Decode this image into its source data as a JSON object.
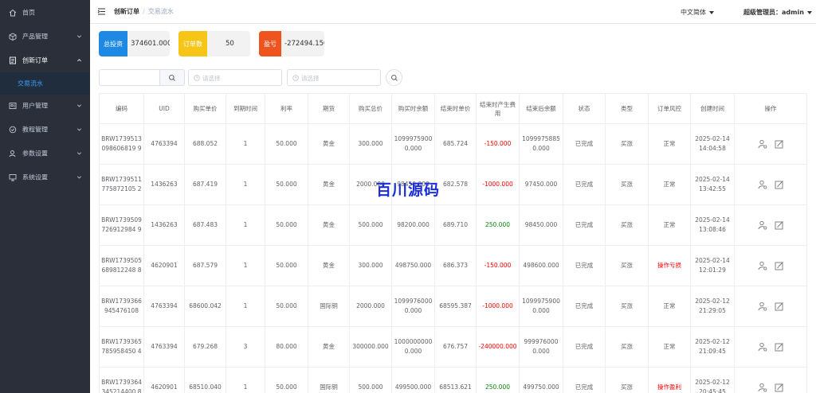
{
  "sidebar": {
    "items": [
      {
        "label": "首页",
        "icon": "home-icon"
      },
      {
        "label": "产品管理",
        "icon": "box-icon"
      },
      {
        "label": "创新订单",
        "icon": "order-icon"
      },
      {
        "label": "用户管理",
        "icon": "user-icon"
      },
      {
        "label": "教程管理",
        "icon": "book-icon"
      },
      {
        "label": "参数设置",
        "icon": "settings-icon"
      },
      {
        "label": "系统设置",
        "icon": "system-icon"
      }
    ],
    "sub_item": "交易流水"
  },
  "header": {
    "crumb1": "创新订单",
    "crumb2": "交易流水",
    "lang": "中文简体",
    "user": "超级管理员：admin"
  },
  "cards": [
    {
      "label": "总投资",
      "value": "374601.000",
      "color": "#1e88e5"
    },
    {
      "label": "订单数",
      "value": "50",
      "color": "#f5c518"
    },
    {
      "label": "盈亏",
      "value": "-272494.150",
      "color": "#f0541e"
    }
  ],
  "filters": {
    "date_placeholder1": "请选择",
    "date_placeholder2": "请选择"
  },
  "table": {
    "headers": [
      "编码",
      "UID",
      "购买单价",
      "到期时间",
      "利率",
      "期货",
      "购买总价",
      "购买时余额",
      "结束时单价",
      "结束时产生费用",
      "结束后余额",
      "状态",
      "类型",
      "订单风控",
      "创建时间",
      "操作"
    ],
    "rows": [
      [
        "BRW1739513098606819 9",
        "4763394",
        "688.052",
        "1",
        "50.000",
        "黄金",
        "300.000",
        "10999759000.000",
        "685.724",
        "-150.000",
        "10999758850.000",
        "已完成",
        "买涨",
        "正常",
        "2025-02-14 14:04:58"
      ],
      [
        "BRW1739511775872105 2",
        "1436263",
        "687.419",
        "1",
        "50.000",
        "黄金",
        "2000.000",
        "98450.000",
        "682.578",
        "-1000.000",
        "97450.000",
        "已完成",
        "买涨",
        "正常",
        "2025-02-14 13:42:55"
      ],
      [
        "BRW1739509726912984 9",
        "1436263",
        "687.483",
        "1",
        "50.000",
        "黄金",
        "500.000",
        "98200.000",
        "689.710",
        "250.000",
        "98450.000",
        "已完成",
        "买涨",
        "正常",
        "2025-02-14 13:08:46"
      ],
      [
        "BRW1739505689812248 8",
        "4620901",
        "687.579",
        "1",
        "50.000",
        "黄金",
        "300.000",
        "498750.000",
        "686.373",
        "-150.000",
        "498600.000",
        "已完成",
        "买涨",
        "操作亏损",
        "2025-02-14 12:01:29"
      ],
      [
        "BRW1739366945476108",
        "4763394",
        "68600.042",
        "1",
        "50.000",
        "国际铜",
        "2000.000",
        "10999760000.000",
        "68595.387",
        "-1000.000",
        "10999759000.000",
        "已完成",
        "买涨",
        "正常",
        "2025-02-12 21:29:05"
      ],
      [
        "BRW1739365785958450 4",
        "4763394",
        "679.268",
        "3",
        "80.000",
        "黄金",
        "300000.000",
        "10000000000.000",
        "676.757",
        "-240000.000",
        "9999760000.000",
        "已完成",
        "买涨",
        "正常",
        "2025-02-12 21:09:45"
      ],
      [
        "BRW1739364345214400 8",
        "4620901",
        "68510.040",
        "1",
        "50.000",
        "国际铜",
        "500.000",
        "499500.000",
        "68513.621",
        "250.000",
        "499750.000",
        "已完成",
        "买涨",
        "操作盈利",
        "2025-02-12 20:45:45"
      ]
    ]
  },
  "watermark": "百川源码"
}
